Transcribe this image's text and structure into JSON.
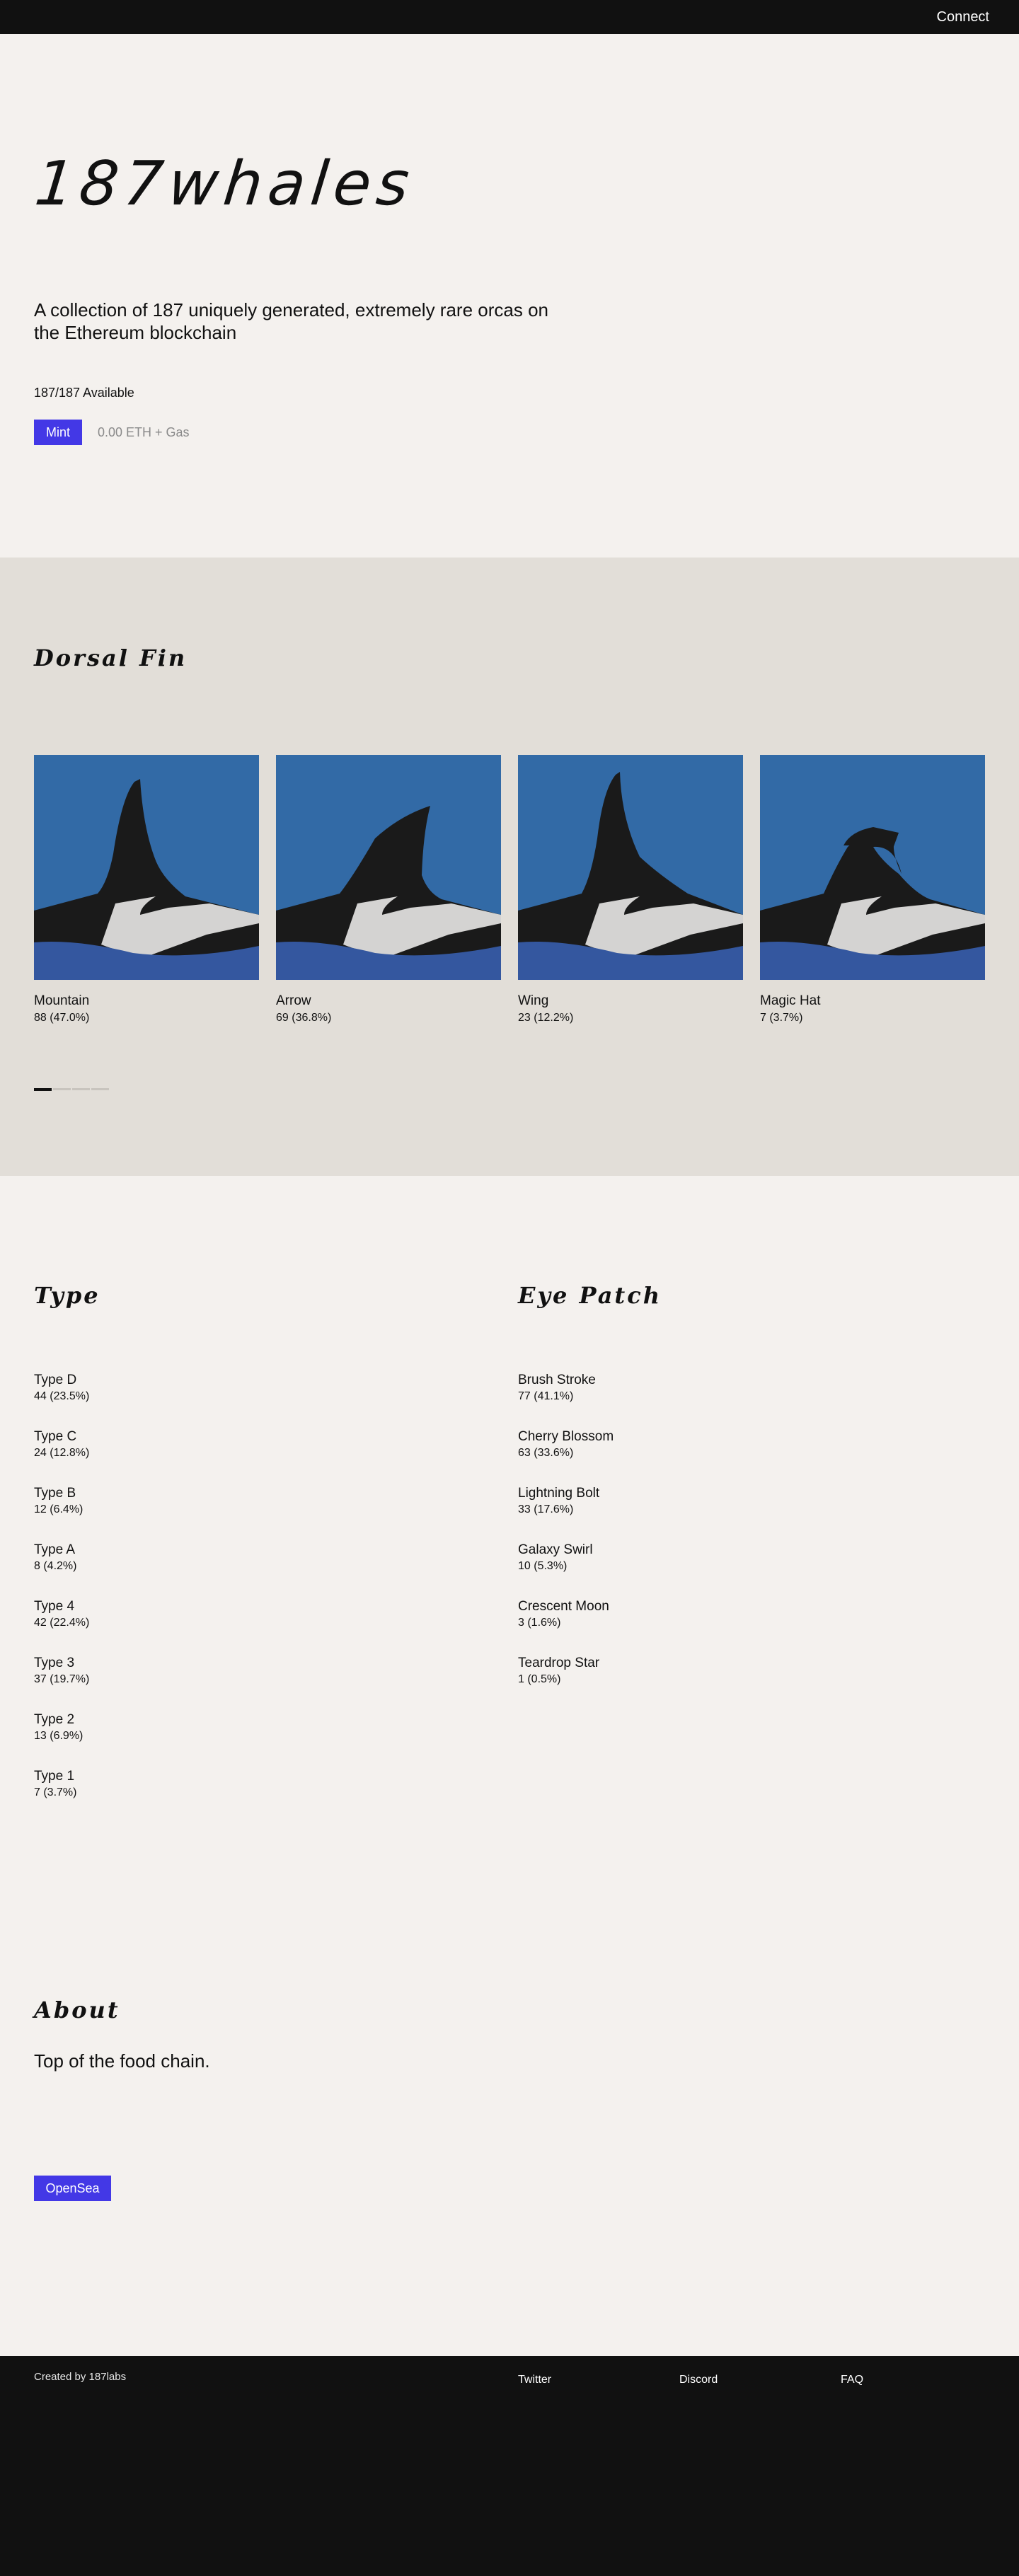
{
  "header": {
    "connect_label": "Connect"
  },
  "hero": {
    "logo": "187whales",
    "tagline": "A collection of 187 uniquely generated, extremely rare orcas on the Ethereum blockchain",
    "available": "187/187 Available",
    "mint_label": "Mint",
    "price": "0.00 ETH + Gas"
  },
  "dorsal_fin": {
    "title": "Dorsal Fin",
    "items": [
      {
        "name": "Mountain",
        "stat": "88 (47.0%)"
      },
      {
        "name": "Arrow",
        "stat": "69 (36.8%)"
      },
      {
        "name": "Wing",
        "stat": "23 (12.2%)"
      },
      {
        "name": "Magic Hat",
        "stat": "7 (3.7%)"
      }
    ],
    "pager_active": 1,
    "colors": {
      "sky": "#326aa6",
      "water": "#34579f",
      "body": "#1a1a1a",
      "patch": "#d4d3d2"
    }
  },
  "type": {
    "title": "Type",
    "items": [
      {
        "name": "Type D",
        "stat": "44 (23.5%)"
      },
      {
        "name": "Type C",
        "stat": "24 (12.8%)"
      },
      {
        "name": "Type B",
        "stat": "12 (6.4%)"
      },
      {
        "name": "Type A",
        "stat": "8 (4.2%)"
      },
      {
        "name": "Type 4",
        "stat": "42 (22.4%)"
      },
      {
        "name": "Type 3",
        "stat": "37 (19.7%)"
      },
      {
        "name": "Type 2",
        "stat": "13 (6.9%)"
      },
      {
        "name": "Type 1",
        "stat": "7 (3.7%)"
      }
    ]
  },
  "eye_patch": {
    "title": "Eye Patch",
    "items": [
      {
        "name": "Brush Stroke",
        "stat": "77 (41.1%)"
      },
      {
        "name": "Cherry Blossom",
        "stat": "63 (33.6%)"
      },
      {
        "name": "Lightning Bolt",
        "stat": "33 (17.6%)"
      },
      {
        "name": "Galaxy Swirl",
        "stat": "10 (5.3%)"
      },
      {
        "name": "Crescent Moon",
        "stat": "3 (1.6%)"
      },
      {
        "name": "Teardrop Star",
        "stat": "1 (0.5%)"
      }
    ]
  },
  "about": {
    "title": "About",
    "text": "Top of the food chain.",
    "opensea_label": "OpenSea"
  },
  "footer": {
    "credit": "Created by 187labs",
    "links": [
      "Twitter",
      "Discord",
      "FAQ"
    ]
  },
  "colors": {
    "accent": "#4338e6",
    "dark": "#111111",
    "hero_bg": "#f4f1ee",
    "section_bg": "#e2ded8"
  }
}
